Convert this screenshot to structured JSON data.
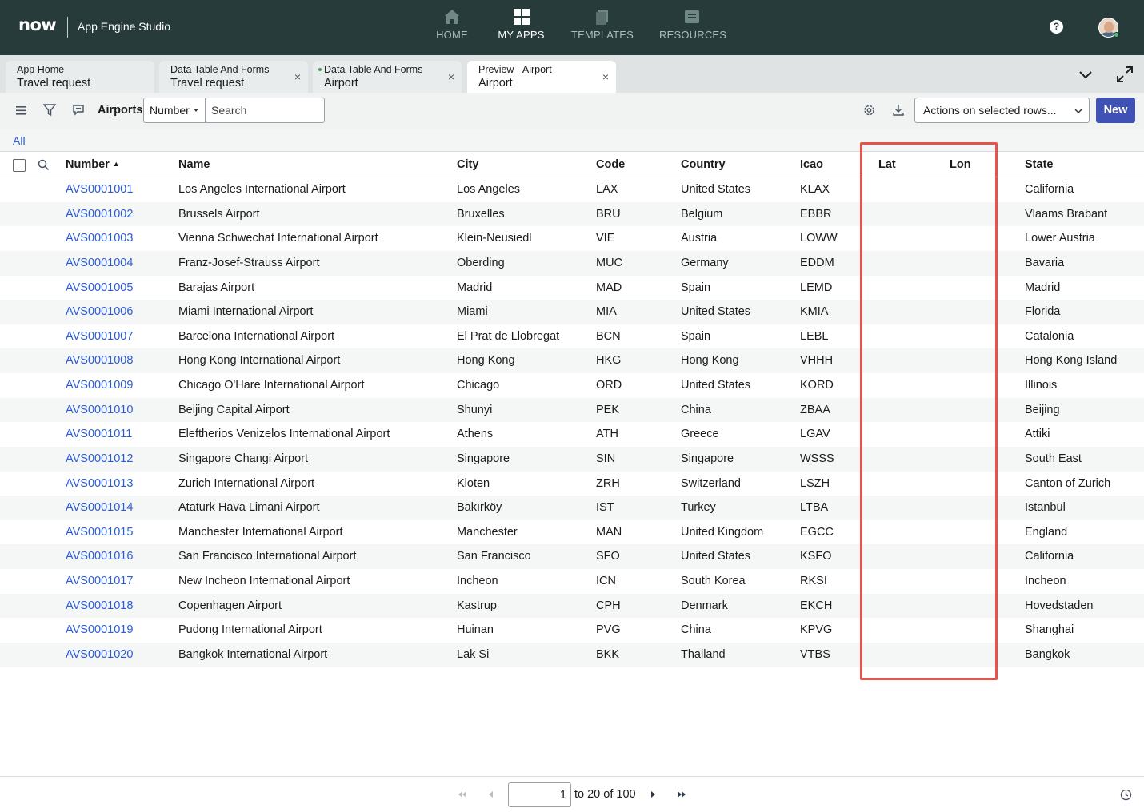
{
  "app": {
    "logo_text": "now",
    "title": "App Engine Studio"
  },
  "nav": {
    "items": [
      {
        "label": "HOME",
        "icon": "home-icon"
      },
      {
        "label": "MY APPS",
        "icon": "grid-icon"
      },
      {
        "label": "TEMPLATES",
        "icon": "templates-icon"
      },
      {
        "label": "RESOURCES",
        "icon": "resources-icon"
      }
    ],
    "active": "MY APPS",
    "help_label": "?"
  },
  "tabs": [
    {
      "line1": "App Home",
      "line2": "Travel request",
      "closable": false
    },
    {
      "line1": "Data Table And Forms",
      "line2": "Travel request",
      "closable": true
    },
    {
      "line1": "Data Table And Forms",
      "line2": "Airport",
      "closable": true,
      "modified": true
    },
    {
      "line1": "Preview - Airport",
      "line2": "Airport",
      "closable": true,
      "active": true
    }
  ],
  "tab_close_glyph": "×",
  "toolbar": {
    "list_title": "Airports",
    "search_field": "Number",
    "search_placeholder": "Search",
    "actions_label": "Actions on selected rows...",
    "new_label": "New"
  },
  "breadcrumb": {
    "all_label": "All"
  },
  "table": {
    "columns": [
      "Number",
      "Name",
      "City",
      "Code",
      "Country",
      "Icao",
      "Lat",
      "Lon",
      "State"
    ],
    "sort_column": "Number",
    "sort_glyph": "▲",
    "rows": [
      [
        "AVS0001001",
        "Los Angeles International Airport",
        "Los Angeles",
        "LAX",
        "United States",
        "KLAX",
        "",
        "",
        "California"
      ],
      [
        "AVS0001002",
        "Brussels Airport",
        "Bruxelles",
        "BRU",
        "Belgium",
        "EBBR",
        "",
        "",
        "Vlaams Brabant"
      ],
      [
        "AVS0001003",
        "Vienna Schwechat International Airport",
        "Klein-Neusiedl",
        "VIE",
        "Austria",
        "LOWW",
        "",
        "",
        "Lower Austria"
      ],
      [
        "AVS0001004",
        "Franz-Josef-Strauss Airport",
        "Oberding",
        "MUC",
        "Germany",
        "EDDM",
        "",
        "",
        "Bavaria"
      ],
      [
        "AVS0001005",
        "Barajas Airport",
        "Madrid",
        "MAD",
        "Spain",
        "LEMD",
        "",
        "",
        "Madrid"
      ],
      [
        "AVS0001006",
        "Miami International Airport",
        "Miami",
        "MIA",
        "United States",
        "KMIA",
        "",
        "",
        "Florida"
      ],
      [
        "AVS0001007",
        "Barcelona International Airport",
        "El Prat de Llobregat",
        "BCN",
        "Spain",
        "LEBL",
        "",
        "",
        "Catalonia"
      ],
      [
        "AVS0001008",
        "Hong Kong International Airport",
        "Hong Kong",
        "HKG",
        "Hong Kong",
        "VHHH",
        "",
        "",
        "Hong Kong Island"
      ],
      [
        "AVS0001009",
        "Chicago O'Hare International Airport",
        "Chicago",
        "ORD",
        "United States",
        "KORD",
        "",
        "",
        "Illinois"
      ],
      [
        "AVS0001010",
        "Beijing Capital Airport",
        "Shunyi",
        "PEK",
        "China",
        "ZBAA",
        "",
        "",
        "Beijing"
      ],
      [
        "AVS0001011",
        "Eleftherios Venizelos International Airport",
        "Athens",
        "ATH",
        "Greece",
        "LGAV",
        "",
        "",
        "Attiki"
      ],
      [
        "AVS0001012",
        "Singapore Changi Airport",
        "Singapore",
        "SIN",
        "Singapore",
        "WSSS",
        "",
        "",
        "South East"
      ],
      [
        "AVS0001013",
        "Zurich International Airport",
        "Kloten",
        "ZRH",
        "Switzerland",
        "LSZH",
        "",
        "",
        "Canton of Zurich"
      ],
      [
        "AVS0001014",
        "Ataturk Hava Limani Airport",
        "Bakırköy",
        "IST",
        "Turkey",
        "LTBA",
        "",
        "",
        "Istanbul"
      ],
      [
        "AVS0001015",
        "Manchester International Airport",
        "Manchester",
        "MAN",
        "United Kingdom",
        "EGCC",
        "",
        "",
        "England"
      ],
      [
        "AVS0001016",
        "San Francisco International Airport",
        "San Francisco",
        "SFO",
        "United States",
        "KSFO",
        "",
        "",
        "California"
      ],
      [
        "AVS0001017",
        "New Incheon International Airport",
        "Incheon",
        "ICN",
        "South Korea",
        "RKSI",
        "",
        "",
        "Incheon"
      ],
      [
        "AVS0001018",
        "Copenhagen Airport",
        "Kastrup",
        "CPH",
        "Denmark",
        "EKCH",
        "",
        "",
        "Hovedstaden"
      ],
      [
        "AVS0001019",
        "Pudong International Airport",
        "Huinan",
        "PVG",
        "China",
        "KPVG",
        "",
        "",
        "Shanghai"
      ],
      [
        "AVS0001020",
        "Bangkok International Airport",
        "Lak Si",
        "BKK",
        "Thailand",
        "VTBS",
        "",
        "",
        "Bangkok"
      ]
    ]
  },
  "pagination": {
    "current_page_value": "1",
    "range_text": "to 20 of 100"
  },
  "colors": {
    "header_bg": "#263b3a",
    "link": "#2a5bd7",
    "primary_button": "#3f51b5",
    "highlight_border": "#e5534b"
  }
}
